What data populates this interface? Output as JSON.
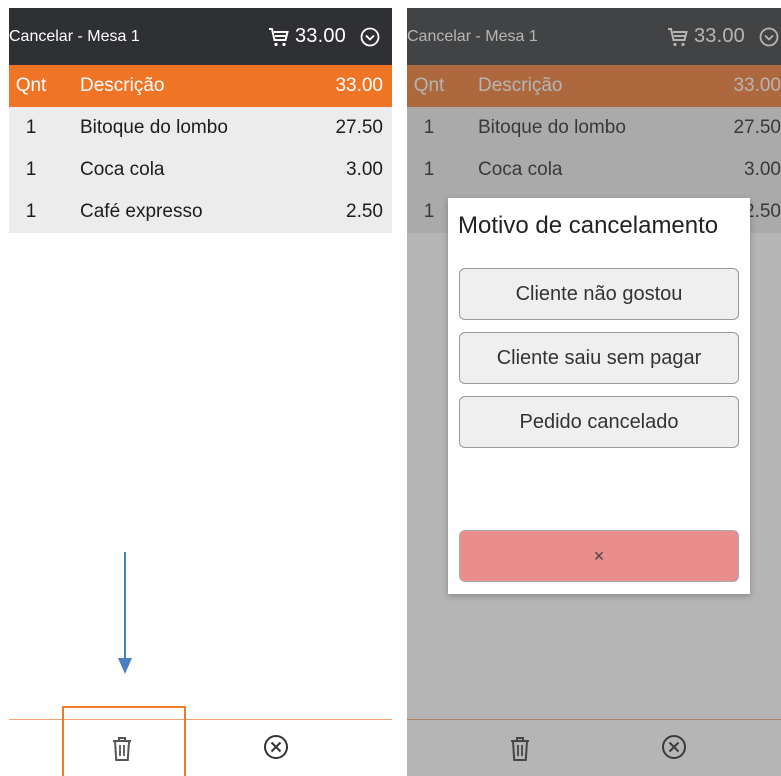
{
  "header": {
    "title": "Cancelar - Mesa 1",
    "total": "33.00",
    "icons": [
      "cart-icon",
      "chevron-down-circle-icon"
    ]
  },
  "table": {
    "columns": {
      "qty": "Qnt",
      "description": "Descrição",
      "total": "33.00"
    },
    "rows": [
      {
        "qty": "1",
        "description": "Bitoque do lombo",
        "price": "27.50"
      },
      {
        "qty": "1",
        "description": "Coca cola",
        "price": "3.00"
      },
      {
        "qty": "1",
        "description": "Café expresso",
        "price": "2.50"
      }
    ]
  },
  "footer": {
    "icons": [
      "trash-icon",
      "close-circle-icon"
    ]
  },
  "dialog": {
    "title": "Motivo de cancelamento",
    "options": [
      "Cliente não gostou",
      "Cliente saiu sem pagar",
      "Pedido cancelado"
    ],
    "close_label": "×"
  },
  "colors": {
    "header_bg": "#2f3033",
    "accent_orange": "#f07426",
    "annotation_arrow": "#4a7fc1",
    "close_button": "#e98d8d"
  }
}
